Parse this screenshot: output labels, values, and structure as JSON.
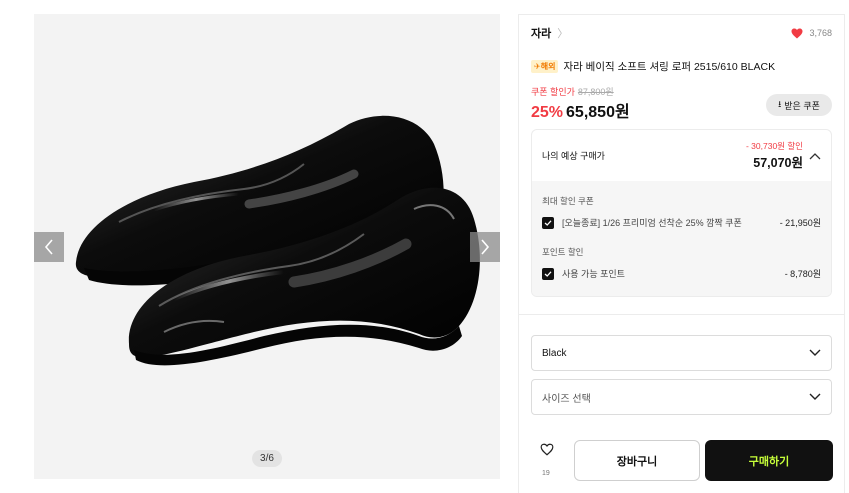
{
  "gallery": {
    "counter": "3/6",
    "prev_icon": "chevron-left-icon",
    "next_icon": "chevron-right-icon"
  },
  "product": {
    "brand": "자라",
    "brand_chevron": "〉",
    "like_count": "3,768",
    "overseas_tag": "✈해외",
    "name": "자라 베이직 소프트 셔링 로퍼 2515/610 BLACK",
    "coupon_price_label": "쿠폰 할인가",
    "original_price": "87,800원",
    "discount_rate": "25%",
    "price": "65,850원",
    "coupon_button": "받은 쿠폰",
    "coupon_icon": "download-icon"
  },
  "estimate": {
    "label": "나의 예상 구매가",
    "discount_total": "- 30,730원 할인",
    "final_price": "57,070원",
    "max_coupon_title": "최대 할인 쿠폰",
    "coupon_item": "[오늘종료] 1/26 프리미엄 선착순 25% 깜짝 쿠폰",
    "coupon_amount": "- 21,950원",
    "point_title": "포인트 할인",
    "point_item": "사용 가능 포인트",
    "point_amount": "- 8,780원"
  },
  "options": {
    "color_selected": "Black",
    "size_placeholder": "사이즈 선택"
  },
  "actions": {
    "wish_count": "19",
    "cart": "장바구니",
    "buy": "구매하기"
  },
  "colors": {
    "accent_red": "#f13b43",
    "buy_text": "#c7ff3a",
    "buy_bg": "#111111"
  }
}
